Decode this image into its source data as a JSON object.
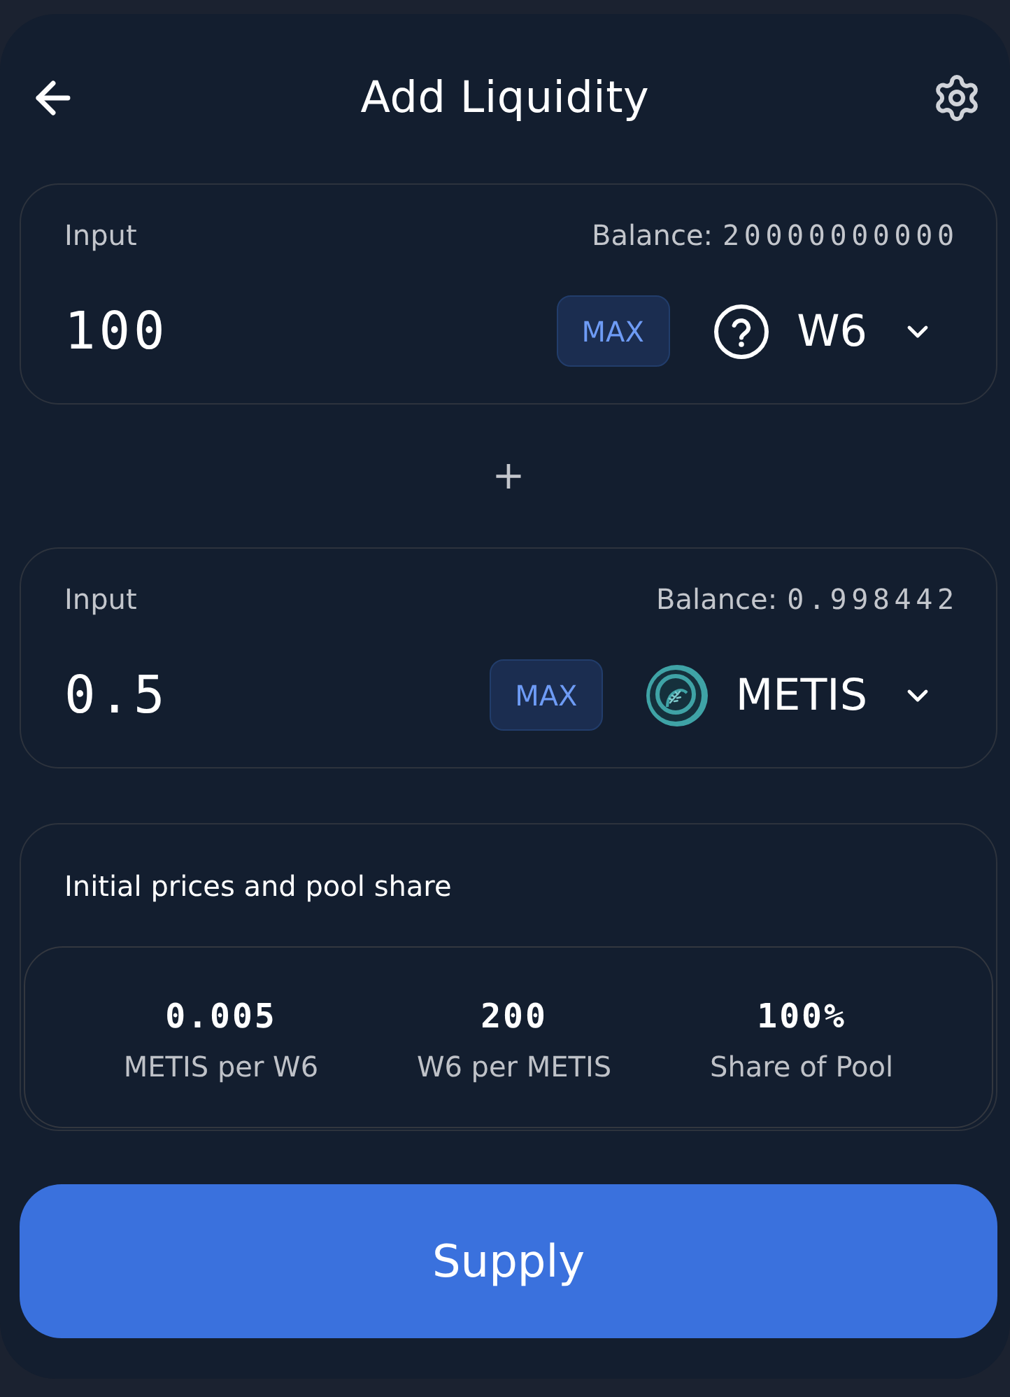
{
  "header": {
    "title": "Add Liquidity"
  },
  "inputs": [
    {
      "label": "Input",
      "balance_label": "Balance:",
      "balance": "20000000000",
      "amount": "100",
      "max_button": "MAX",
      "token": {
        "symbol": "W6",
        "kind": "unknown"
      }
    },
    {
      "label": "Input",
      "balance_label": "Balance:",
      "balance": "0.998442",
      "amount": "0.5",
      "max_button": "MAX",
      "token": {
        "symbol": "METIS",
        "kind": "logo"
      }
    }
  ],
  "separator": "+",
  "prices": {
    "title": "Initial prices and pool share",
    "stats": [
      {
        "value": "0.005",
        "label": "METIS per W6"
      },
      {
        "value": "200",
        "label": "W6 per METIS"
      },
      {
        "value": "100%",
        "label": "Share of Pool"
      }
    ]
  },
  "supply_button": "Supply"
}
